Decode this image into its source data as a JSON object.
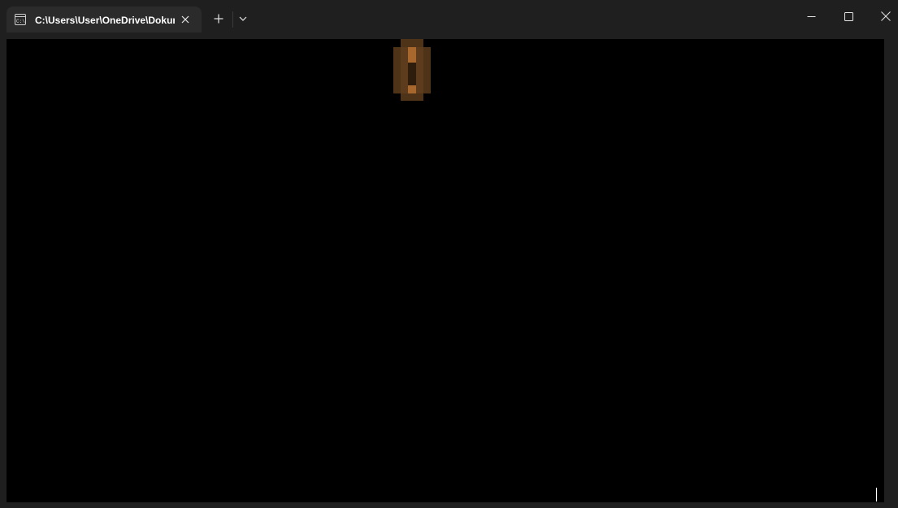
{
  "window": {
    "tab": {
      "title": "C:\\Users\\User\\OneDrive\\Dokumente",
      "icon": "terminal-cmd-icon"
    },
    "buttons": {
      "close_tab_icon": "close-icon",
      "new_tab_icon": "plus-icon",
      "dropdown_icon": "chevron-down-icon",
      "minimize_icon": "minimize-icon",
      "maximize_icon": "maximize-icon",
      "close_window_icon": "close-icon"
    }
  },
  "terminal": {
    "background": "#000000",
    "sprite": "door-sprite",
    "sprite_colors": {
      "dark": "#4f3318",
      "mid": "#7a4a1f",
      "light": "#a8682d",
      "shadow": "#2e1c0c"
    }
  },
  "colors": {
    "chrome": "#1f1f1f",
    "tab_active": "#2b2b2b",
    "text": "#ffffff"
  }
}
